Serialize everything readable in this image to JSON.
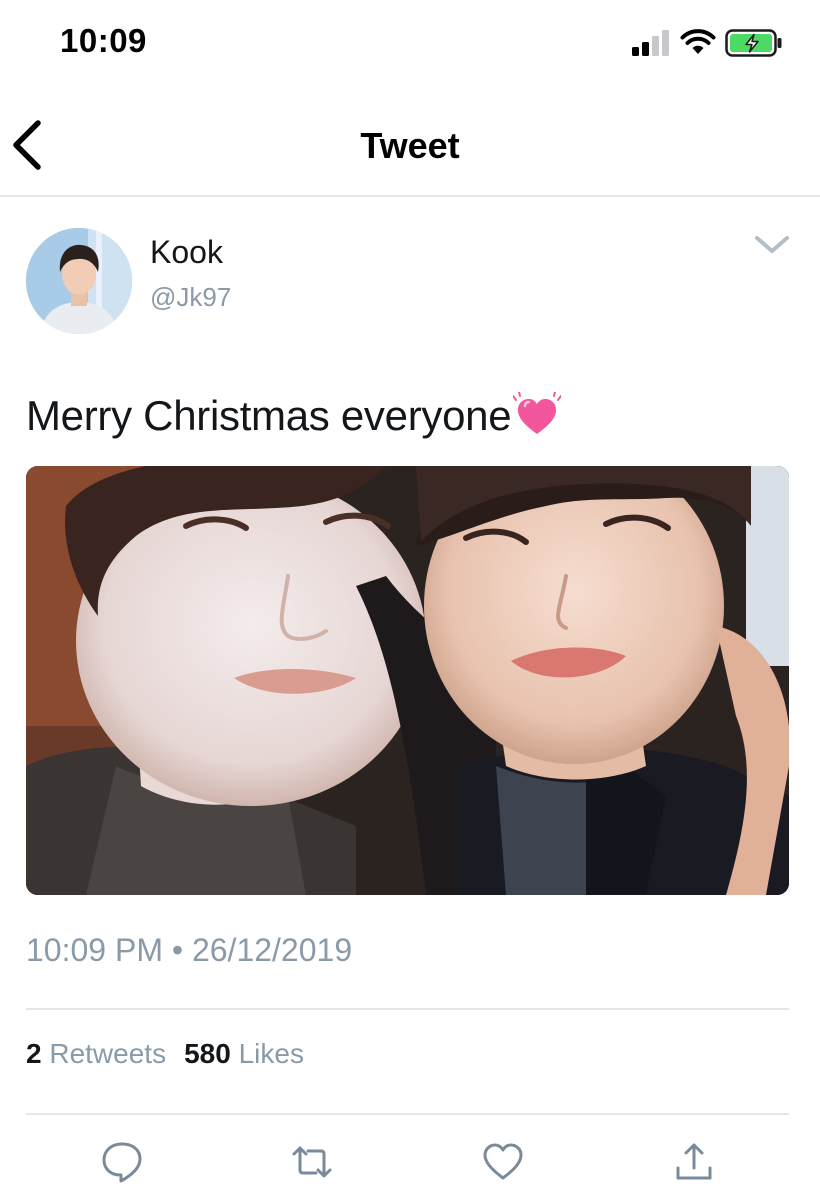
{
  "status_bar": {
    "time": "10:09",
    "icons": [
      "signal-icon",
      "wifi-icon",
      "battery-charging-icon"
    ]
  },
  "nav": {
    "title": "Tweet",
    "back_icon": "chevron-left-icon"
  },
  "tweet": {
    "author_name": "Kook",
    "author_handle": "@Jk97",
    "text": "Merry Christmas everyone",
    "emoji": "beating-heart-emoji",
    "time": "10:09 PM",
    "separator": "•",
    "date": "26/12/2019",
    "stats": {
      "retweets_count": "2",
      "retweets_label": "Retweets",
      "likes_count": "580",
      "likes_label": "Likes"
    }
  },
  "actions": [
    "reply-icon",
    "retweet-icon",
    "like-icon",
    "share-icon"
  ],
  "colors": {
    "text": "#14171a",
    "secondary_text": "#8a9aa8",
    "divider": "#e1e8ed",
    "action_icon": "#7a8a98",
    "battery_fill": "#4cd964",
    "heart_pink": "#f2579d"
  }
}
